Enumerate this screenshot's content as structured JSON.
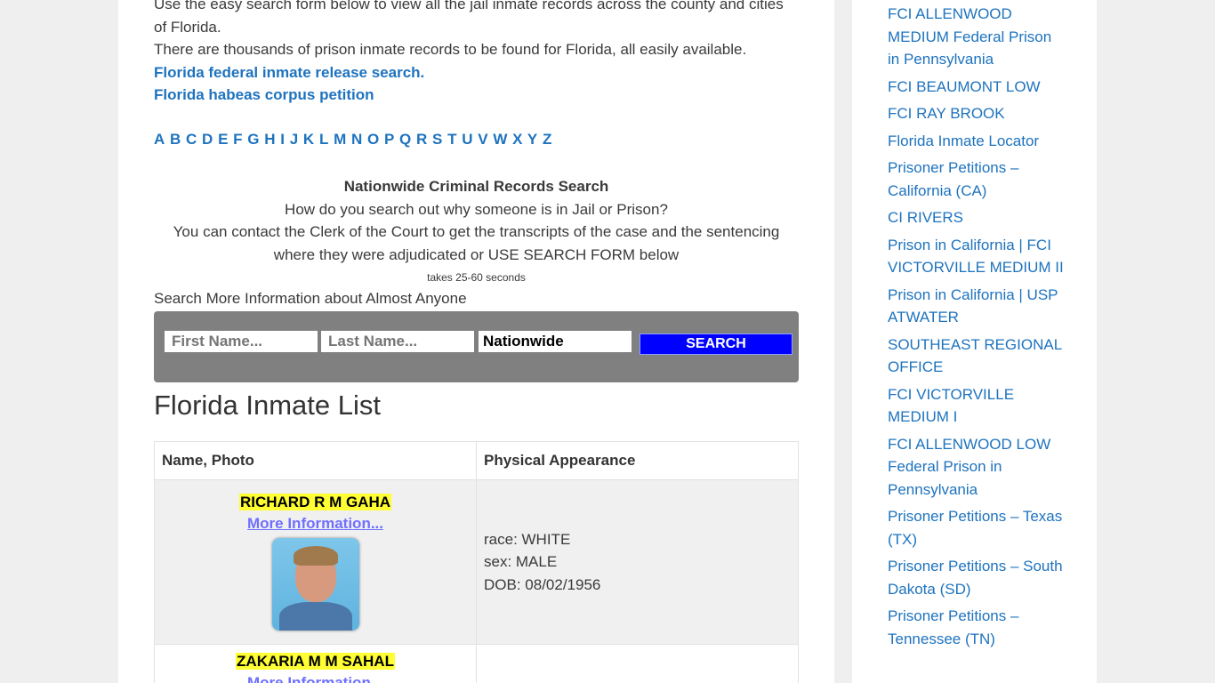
{
  "intro": {
    "line1": "Use the easy search form below to view all the jail inmate records across the county and cities of Florida.",
    "line2": "There are thousands of prison inmate records to be found for Florida, all easily available.",
    "link1": "Florida federal inmate release search.",
    "link2": "Florida habeas corpus petition"
  },
  "alphabet": [
    "A",
    "B",
    "C",
    "D",
    "E",
    "F",
    "G",
    "H",
    "I",
    "J",
    "K",
    "L",
    "M",
    "N",
    "O",
    "P",
    "Q",
    "R",
    "S",
    "T",
    "U",
    "V",
    "W",
    "X",
    "Y",
    "Z"
  ],
  "nationwide": {
    "title": "Nationwide Criminal Records Search",
    "question": "How do you search out why someone is in Jail or Prison?",
    "answer": "You can contact the Clerk of the Court to get the transcripts of the case and the sentencing where they were adjudicated or USE SEARCH FORM below",
    "timing": "takes 25-60 seconds"
  },
  "search": {
    "heading": "Search More Information about Almost Anyone",
    "first_placeholder": "First Name...",
    "last_placeholder": "Last Name...",
    "location_value": "Nationwide",
    "button_label": "SEARCH"
  },
  "list": {
    "title": "Florida Inmate List",
    "columns": [
      "Name, Photo",
      "Physical Appearance"
    ],
    "rows": [
      {
        "name": "RICHARD R M GAHA",
        "more": "More Information...",
        "race": "race: WHITE",
        "sex": "sex: MALE",
        "dob": "DOB: 08/02/1956"
      },
      {
        "name": "ZAKARIA M M SAHAL",
        "more": "More Information..."
      }
    ]
  },
  "sidebar": {
    "links": [
      "FCI ALLENWOOD MEDIUM Federal Prison in Pennsylvania",
      "FCI BEAUMONT LOW",
      "FCI RAY BROOK",
      "Florida Inmate Locator",
      "Prisoner Petitions – California (CA)",
      "CI RIVERS",
      "Prison in California | FCI VICTORVILLE MEDIUM II",
      "Prison in California | USP ATWATER",
      "SOUTHEAST REGIONAL OFFICE",
      "FCI VICTORVILLE MEDIUM I",
      "FCI ALLENWOOD LOW Federal Prison in Pennsylvania",
      "Prisoner Petitions – Texas (TX)",
      "Prisoner Petitions – South Dakota (SD)",
      "Prisoner Petitions – Tennessee (TN)"
    ]
  }
}
